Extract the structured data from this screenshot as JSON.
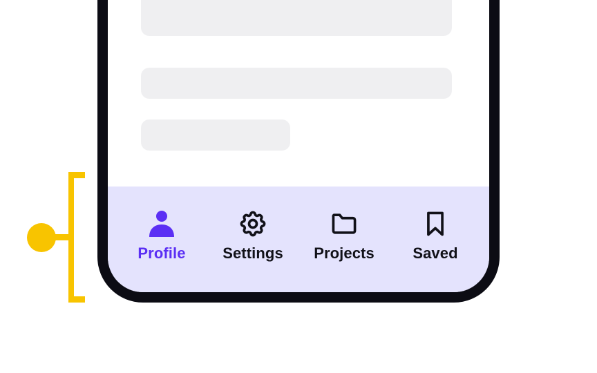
{
  "tabbar": {
    "tabs": [
      {
        "label": "Profile",
        "icon": "person-icon",
        "active": true
      },
      {
        "label": "Settings",
        "icon": "gear-icon",
        "active": false
      },
      {
        "label": "Projects",
        "icon": "folder-icon",
        "active": false
      },
      {
        "label": "Saved",
        "icon": "bookmark-icon",
        "active": false
      }
    ]
  },
  "colors": {
    "accent": "#5b2ff4",
    "tabbar_bg": "#e4e3fd",
    "frame": "#0c0c14",
    "skeleton": "#efeff1",
    "annotation": "#f8c400"
  }
}
